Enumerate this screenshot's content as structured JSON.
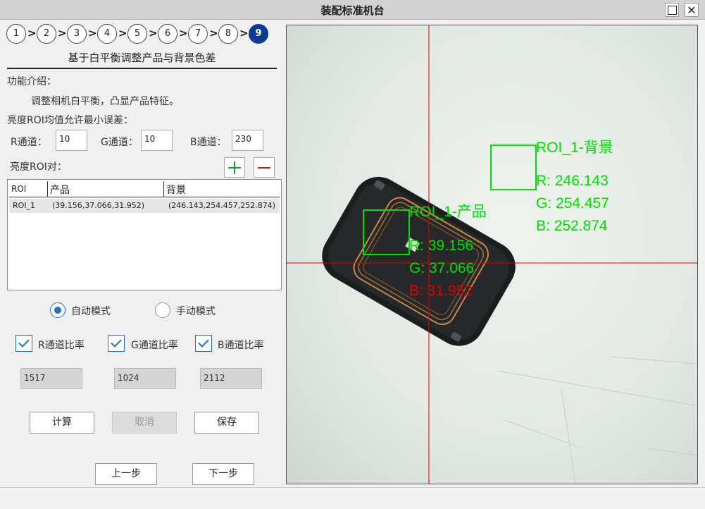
{
  "window": {
    "title": "装配标准机台"
  },
  "steps": {
    "items": [
      "1",
      "2",
      "3",
      "4",
      "5",
      "6",
      "7",
      "8",
      "9"
    ],
    "active": "9"
  },
  "section": {
    "title": "基于白平衡调整产品与背景色差"
  },
  "intro": {
    "label": "功能介绍：",
    "text": "调整相机白平衡，凸显产品特征。"
  },
  "tolerance": {
    "label": "亮度ROI均值允许最小误差：",
    "r_label": "R通道：",
    "r_value": "10",
    "g_label": "G通道：",
    "g_value": "10",
    "b_label": "B通道：",
    "b_value": "230"
  },
  "roi_pairs": {
    "label": "亮度ROI对：",
    "columns": [
      "ROI",
      "产品",
      "背景"
    ],
    "rows": [
      {
        "roi": "ROI_1",
        "product": "(39.156,37.066,31.952)",
        "background": "(246.143,254.457,252.874)"
      }
    ]
  },
  "mode": {
    "auto_label": "自动模式",
    "manual_label": "手动模式",
    "selected": "auto"
  },
  "ratios": {
    "r_label": "R通道比率",
    "g_label": "G通道比率",
    "b_label": "B通道比率",
    "r_value": "1517",
    "g_value": "1024",
    "b_value": "2112",
    "r_checked": true,
    "g_checked": true,
    "b_checked": true
  },
  "actions": {
    "calc": "计算",
    "cancel": "取消",
    "save": "保存",
    "prev": "上一步",
    "next": "下一步"
  },
  "viewer": {
    "product_label": "ROI_1-产品",
    "product_r": "R: 39.156",
    "product_g": "G: 37.066",
    "product_b": "B: 31.952",
    "bg_label": "ROI_1-背景",
    "bg_r": "R: 246.143",
    "bg_g": "G: 254.457",
    "bg_b": "B: 252.874",
    "colors": {
      "overlay_green": "#00e000",
      "crosshair_red": "#e00000",
      "warning_red": "#e00000"
    }
  }
}
